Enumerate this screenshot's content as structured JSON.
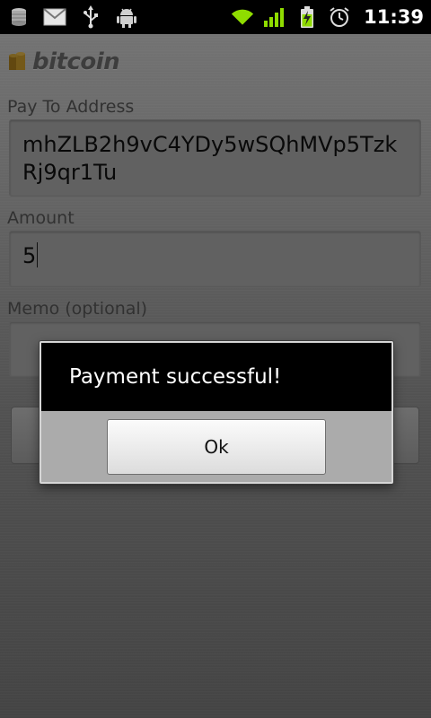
{
  "status_bar": {
    "icons": [
      "coins-icon",
      "gmail-icon",
      "usb-icon",
      "android-debug-icon"
    ],
    "right_icons": [
      "wifi-icon",
      "signal-icon",
      "battery-charging-icon",
      "alarm-icon"
    ],
    "time": "11:39",
    "colors": {
      "wifi": "#8fdc00",
      "signal": "#8fdc00",
      "battery": "#8fdc00"
    }
  },
  "app": {
    "logo_text": "bitcoin",
    "form": {
      "pay_to_label": "Pay To Address",
      "pay_to_value": "mhZLB2h9vC4YDy5wSQhMVp5TzkRj9qr1Tu",
      "amount_label": "Amount",
      "amount_value": "5",
      "memo_label": "Memo (optional)",
      "memo_value": ""
    }
  },
  "dialog": {
    "message": "Payment successful!",
    "ok_label": "Ok"
  }
}
